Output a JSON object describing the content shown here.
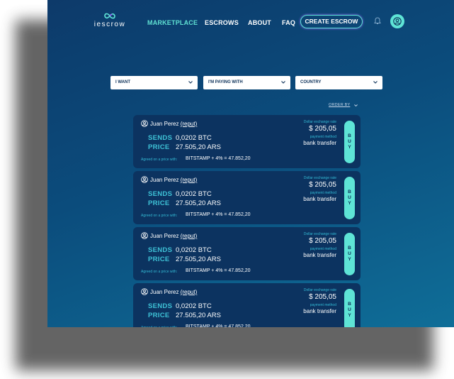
{
  "header": {
    "logo_text": "iescrow",
    "nav": [
      "MARKETPLACE",
      "ESCROWS",
      "ABOUT",
      "FAQ"
    ],
    "create_label": "CREATE ESCROW"
  },
  "filters": [
    "I WANT",
    "I'M PAYING WITH",
    "COUNTRY"
  ],
  "order_by": "ORDER BY",
  "offer": {
    "user": "Juan Perez",
    "reput": "(reput)",
    "sends_label": "SENDS",
    "sends_value": "0,0202 BTC",
    "price_label": "PRICE",
    "price_value": "27.505,20 ARS",
    "agreed_label": "Agreed on a price with:",
    "formula": "BITSTAMP + 4% = 47.852,20",
    "rate_label": "Dollar exchange rate",
    "rate_value": "$ 205,05",
    "payment_label": "payment method",
    "payment_value": "bank transfer",
    "buy_label": "BUY"
  },
  "colors": {
    "accent": "#5ee4d6",
    "card": "#0c3360",
    "label": "#3ec2d6"
  }
}
